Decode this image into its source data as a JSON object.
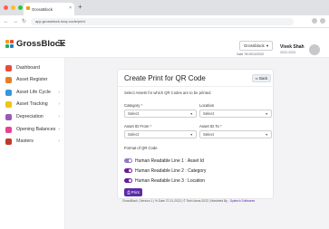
{
  "browser": {
    "tab_title": "GrossBlock",
    "tab_close": "×",
    "new_tab": "+",
    "nav": [
      "←",
      "→",
      "↻"
    ],
    "url": "app.grossblock.in/qr-code/print"
  },
  "header": {
    "brand": "GrossBlock",
    "company_selector": "Grossblock",
    "company_caret": "▾",
    "valid_till": "Valid Till 09/10/2022",
    "user_name": "Vivek Shah",
    "fiscal_year": "2022-2023"
  },
  "sidebar": {
    "items": [
      {
        "label": "Dashboard",
        "color": "#e74c3c",
        "chevron": ""
      },
      {
        "label": "Asset Register",
        "color": "#e67e22",
        "chevron": ""
      },
      {
        "label": "Asset Life Cycle",
        "color": "#3498db",
        "chevron": "›"
      },
      {
        "label": "Asset Tracking",
        "color": "#f1c40f",
        "chevron": "›"
      },
      {
        "label": "Depreciation",
        "color": "#9b59b6",
        "chevron": "›"
      },
      {
        "label": "Opening Balances",
        "color": "#e84393",
        "chevron": "›"
      },
      {
        "label": "Masters",
        "color": "#c0392b",
        "chevron": "›"
      }
    ]
  },
  "card": {
    "title": "Create Print for QR Code",
    "back_label": "Back",
    "subtitle": "Select Assets for which QR Codes are to be printed",
    "category_label": "Category",
    "location_label": "Location",
    "asset_from_label": "Asset ID From",
    "asset_to_label": "Asset ID To",
    "required_mark": "*",
    "select_placeholder": "Select",
    "format_label": "Format of QR Code",
    "toggles": [
      {
        "label": "Human Readable Line 1 : Asset Id",
        "on": true
      },
      {
        "label": "Human Readable Line 2 : Category",
        "on": true
      },
      {
        "label": "Human Readable Line 3 : Location",
        "on": true
      }
    ],
    "print_label": "Print"
  },
  "footer": {
    "text": "GrossBlock | Version 1 | % Date 27-01-2022 | © Tech Ideas 2022 | Marketed By :",
    "marketer": "Dystech Softwares"
  },
  "colors": {
    "accent": "#5b2ba6",
    "toggle_on": "#6a1b9a"
  }
}
